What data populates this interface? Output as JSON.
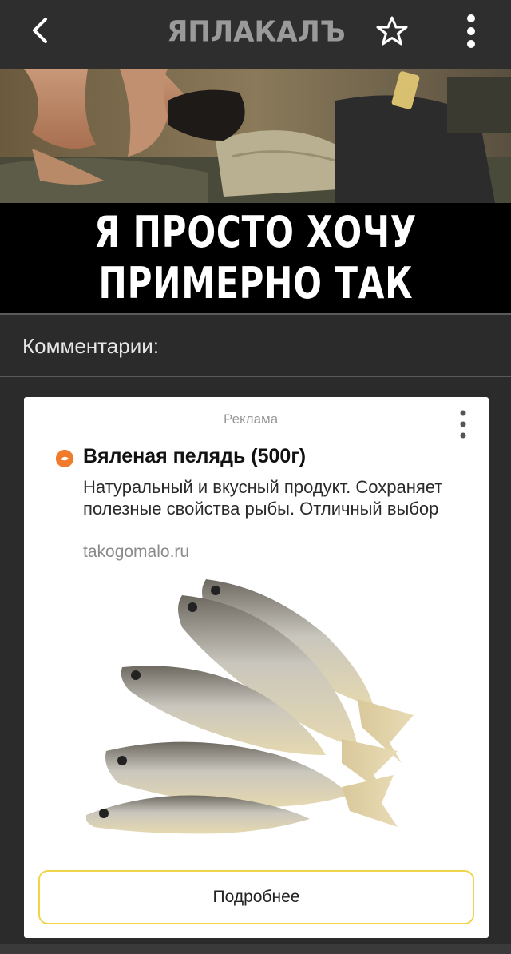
{
  "topbar": {
    "logo_text": "ЯПЛАКАЛЪ",
    "icons": {
      "back": "chevron-left-icon",
      "favorite": "star-icon",
      "menu": "more-vertical-icon"
    }
  },
  "meme": {
    "caption_line1": "Я ПРОСТО ХОЧУ",
    "caption_line2": "ПРИМЕРНО ТАК"
  },
  "comments": {
    "heading": "Комментарии:"
  },
  "ad": {
    "label": "Реклама",
    "title": "Вяленая пелядь (500г)",
    "description": "Натуральный и вкусный продукт. Сохраняет полезные свойства рыбы. Отличный выбор",
    "domain": "takogomalo.ru",
    "cta": "Подробнее",
    "favicon": "brand-favicon-icon",
    "accent_color": "#f2d44a"
  },
  "colors": {
    "topbar": "#2e2e2e",
    "background": "#2b2b2b",
    "logo": "#9a9a9a"
  }
}
